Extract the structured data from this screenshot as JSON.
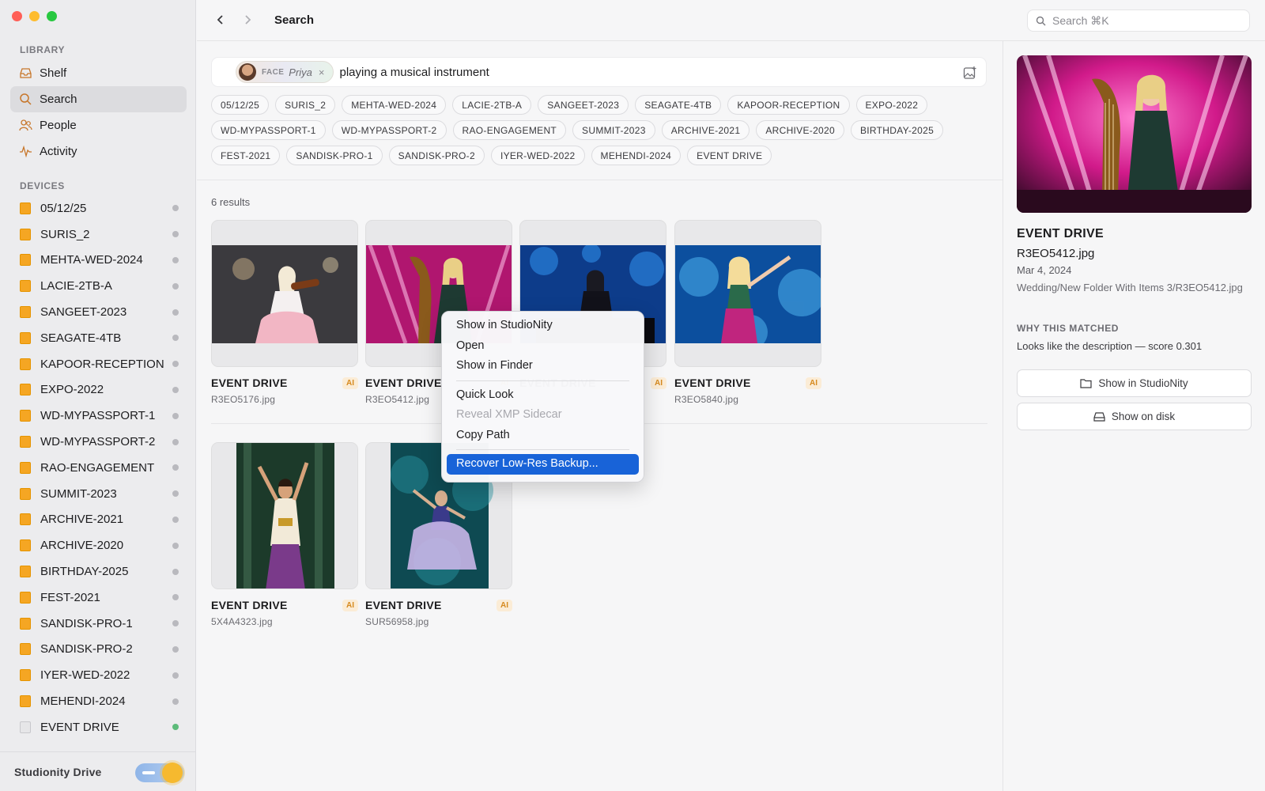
{
  "window": {
    "traffic_colors": [
      "#ff5f57",
      "#febc2e",
      "#28c840"
    ]
  },
  "sidebar": {
    "library_label": "LIBRARY",
    "library_items": [
      {
        "label": "Shelf",
        "icon": "tray-icon"
      },
      {
        "label": "Search",
        "icon": "search-icon",
        "active": true
      },
      {
        "label": "People",
        "icon": "people-icon"
      },
      {
        "label": "Activity",
        "icon": "activity-icon"
      }
    ],
    "devices_label": "DEVICES",
    "devices": [
      {
        "label": "05/12/25",
        "online": false
      },
      {
        "label": "SURIS_2",
        "online": false
      },
      {
        "label": "MEHTA-WED-2024",
        "online": false
      },
      {
        "label": "LACIE-2TB-A",
        "online": false
      },
      {
        "label": "SANGEET-2023",
        "online": false
      },
      {
        "label": "SEAGATE-4TB",
        "online": false
      },
      {
        "label": "KAPOOR-RECEPTION",
        "online": false
      },
      {
        "label": "EXPO-2022",
        "online": false
      },
      {
        "label": "WD-MYPASSPORT-1",
        "online": false
      },
      {
        "label": "WD-MYPASSPORT-2",
        "online": false
      },
      {
        "label": "RAO-ENGAGEMENT",
        "online": false
      },
      {
        "label": "SUMMIT-2023",
        "online": false
      },
      {
        "label": "ARCHIVE-2021",
        "online": false
      },
      {
        "label": "ARCHIVE-2020",
        "online": false
      },
      {
        "label": "BIRTHDAY-2025",
        "online": false
      },
      {
        "label": "FEST-2021",
        "online": false
      },
      {
        "label": "SANDISK-PRO-1",
        "online": false
      },
      {
        "label": "SANDISK-PRO-2",
        "online": false
      },
      {
        "label": "IYER-WED-2022",
        "online": false
      },
      {
        "label": "MEHENDI-2024",
        "online": false
      },
      {
        "label": "EVENT DRIVE",
        "online": true,
        "external": true
      }
    ],
    "footer_label": "Studionity Drive",
    "footer_toggle_on": true
  },
  "topbar": {
    "title": "Search",
    "search_placeholder": "Search ⌘K"
  },
  "query": {
    "face_tag": "FACE",
    "face_name": "Priya",
    "face_remove": "×",
    "text": "playing a musical instrument"
  },
  "filters": [
    "05/12/25",
    "SURIS_2",
    "MEHTA-WED-2024",
    "LACIE-2TB-A",
    "SANGEET-2023",
    "SEAGATE-4TB",
    "KAPOOR-RECEPTION",
    "EXPO-2022",
    "WD-MYPASSPORT-1",
    "WD-MYPASSPORT-2",
    "RAO-ENGAGEMENT",
    "SUMMIT-2023",
    "ARCHIVE-2021",
    "ARCHIVE-2020",
    "BIRTHDAY-2025",
    "FEST-2021",
    "SANDISK-PRO-1",
    "SANDISK-PRO-2",
    "IYER-WED-2022",
    "MEHENDI-2024",
    "EVENT DRIVE"
  ],
  "results": {
    "count_label": "6 results",
    "items": [
      {
        "drive": "EVENT DRIVE",
        "file": "R3EO5176.jpg",
        "badge": "AI",
        "scene": "violin"
      },
      {
        "drive": "EVENT DRIVE",
        "file": "R3EO5412.jpg",
        "badge": "AI",
        "scene": "harp"
      },
      {
        "drive": "EVENT DRIVE",
        "file": "",
        "badge": "AI",
        "scene": "piano"
      },
      {
        "drive": "EVENT DRIVE",
        "file": "R3EO5840.jpg",
        "badge": "AI",
        "scene": "singer"
      },
      {
        "drive": "EVENT DRIVE",
        "file": "5X4A4323.jpg",
        "badge": "AI",
        "scene": "dancer-green"
      },
      {
        "drive": "EVENT DRIVE",
        "file": "SUR56958.jpg",
        "badge": "AI",
        "scene": "dancer-teal"
      }
    ]
  },
  "context_menu": {
    "groups": [
      [
        {
          "label": "Show in StudioNity"
        },
        {
          "label": "Open"
        },
        {
          "label": "Show in Finder"
        }
      ],
      [
        {
          "label": "Quick Look"
        },
        {
          "label": "Reveal XMP Sidecar",
          "disabled": true
        },
        {
          "label": "Copy Path"
        }
      ],
      [
        {
          "label": "Recover Low-Res Backup...",
          "highlighted": true
        }
      ]
    ]
  },
  "details": {
    "drive": "EVENT DRIVE",
    "file": "R3EO5412.jpg",
    "date": "Mar 4, 2024",
    "path": "Wedding/New Folder With Items 3/R3EO5412.jpg",
    "why_label": "WHY THIS MATCHED",
    "why_text": "Looks like the description — score 0.301",
    "show_button": "Show in StudioNity",
    "disk_button": "Show on disk"
  },
  "colors": {
    "accent": "#1863d8",
    "drive_icon": "#f5a623",
    "online_dot": "#5dbb7a",
    "ai_badge": "#d68a1f"
  }
}
